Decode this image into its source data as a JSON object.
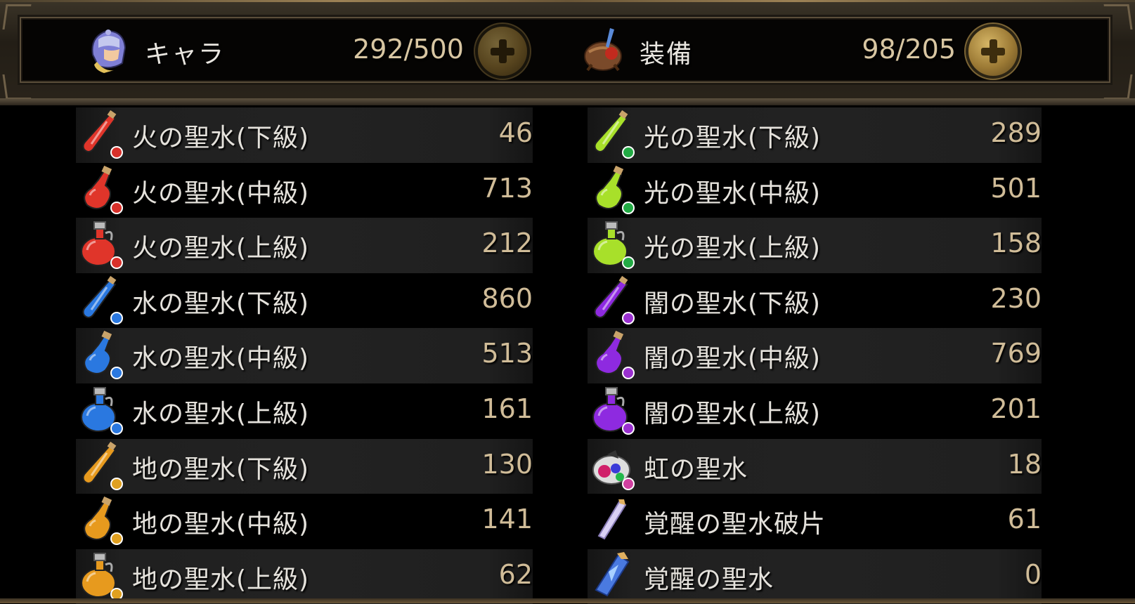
{
  "header": {
    "chara": {
      "label": "キャラ",
      "count": "292/500"
    },
    "equip": {
      "label": "装備",
      "count": "98/205"
    }
  },
  "colors": {
    "fire": "#e0352a",
    "water": "#2a78e0",
    "earth": "#e79a1e",
    "light": "#a8e02a",
    "dark": "#8e2ae0"
  },
  "items_left": [
    {
      "name": "火の聖水(下級)",
      "qty": "46",
      "element": "fire",
      "tier": "low",
      "icon": "fire-potion-icon"
    },
    {
      "name": "火の聖水(中級)",
      "qty": "713",
      "element": "fire",
      "tier": "mid",
      "icon": "fire-potion-icon"
    },
    {
      "name": "火の聖水(上級)",
      "qty": "212",
      "element": "fire",
      "tier": "high",
      "icon": "fire-potion-icon"
    },
    {
      "name": "水の聖水(下級)",
      "qty": "860",
      "element": "water",
      "tier": "low",
      "icon": "water-potion-icon"
    },
    {
      "name": "水の聖水(中級)",
      "qty": "513",
      "element": "water",
      "tier": "mid",
      "icon": "water-potion-icon"
    },
    {
      "name": "水の聖水(上級)",
      "qty": "161",
      "element": "water",
      "tier": "high",
      "icon": "water-potion-icon"
    },
    {
      "name": "地の聖水(下級)",
      "qty": "130",
      "element": "earth",
      "tier": "low",
      "icon": "earth-potion-icon"
    },
    {
      "name": "地の聖水(中級)",
      "qty": "141",
      "element": "earth",
      "tier": "mid",
      "icon": "earth-potion-icon"
    },
    {
      "name": "地の聖水(上級)",
      "qty": "62",
      "element": "earth",
      "tier": "high",
      "icon": "earth-potion-icon"
    }
  ],
  "items_right": [
    {
      "name": "光の聖水(下級)",
      "qty": "289",
      "element": "light",
      "tier": "low",
      "icon": "light-potion-icon"
    },
    {
      "name": "光の聖水(中級)",
      "qty": "501",
      "element": "light",
      "tier": "mid",
      "icon": "light-potion-icon"
    },
    {
      "name": "光の聖水(上級)",
      "qty": "158",
      "element": "light",
      "tier": "high",
      "icon": "light-potion-icon"
    },
    {
      "name": "闇の聖水(下級)",
      "qty": "230",
      "element": "dark",
      "tier": "low",
      "icon": "dark-potion-icon"
    },
    {
      "name": "闇の聖水(中級)",
      "qty": "769",
      "element": "dark",
      "tier": "mid",
      "icon": "dark-potion-icon"
    },
    {
      "name": "闇の聖水(上級)",
      "qty": "201",
      "element": "dark",
      "tier": "high",
      "icon": "dark-potion-icon"
    },
    {
      "name": "虹の聖水",
      "qty": "18",
      "element": "rainbow",
      "tier": "special",
      "icon": "rainbow-potion-icon"
    },
    {
      "name": "覚醒の聖水破片",
      "qty": "61",
      "element": "shard",
      "tier": "special",
      "icon": "crystal-shard-icon"
    },
    {
      "name": "覚醒の聖水",
      "qty": "0",
      "element": "crystal",
      "tier": "special",
      "icon": "crystal-icon"
    }
  ]
}
